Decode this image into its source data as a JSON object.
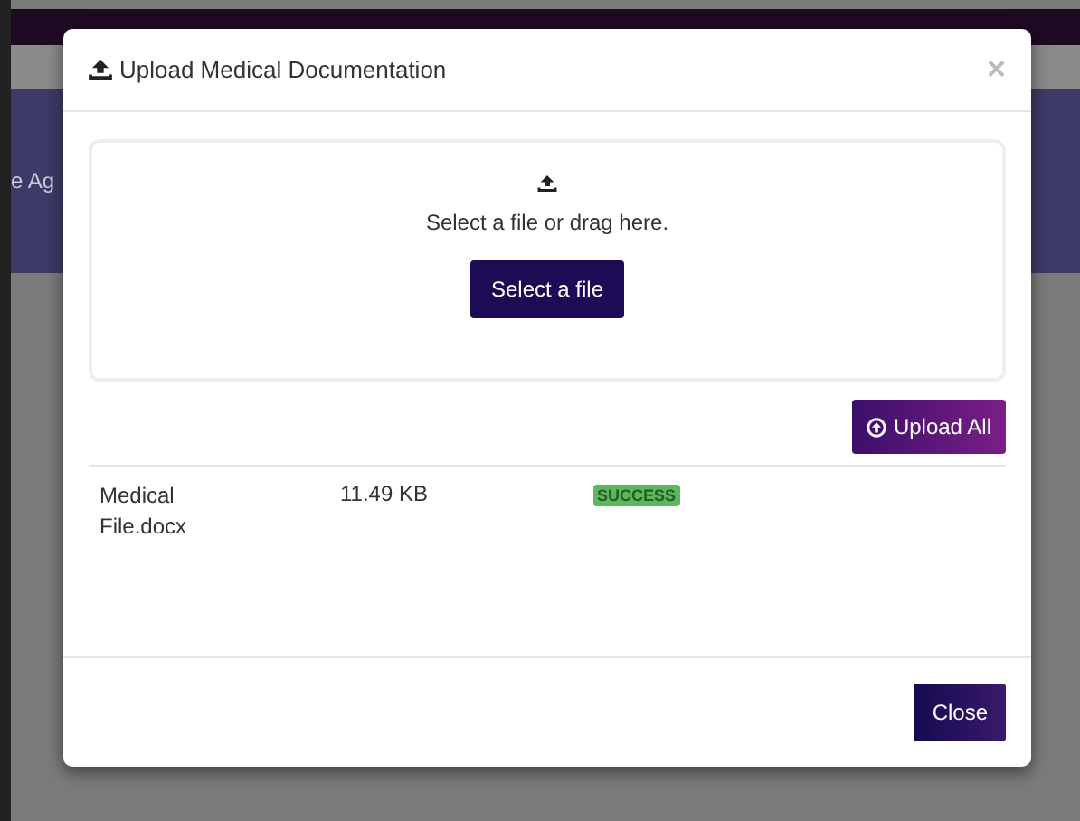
{
  "background": {
    "banner_text": "e Ag"
  },
  "dialog": {
    "title": "Upload Medical Documentation",
    "close_symbol": "×",
    "dropzone": {
      "prompt": "Select a file or drag here.",
      "button": "Select a file"
    },
    "upload_all_button": "Upload All",
    "files": [
      {
        "name": "Medical File.docx",
        "size": "11.49 KB",
        "status": {
          "text": "SUCCESS",
          "kind": "success"
        }
      }
    ],
    "footer_button": "Close"
  }
}
